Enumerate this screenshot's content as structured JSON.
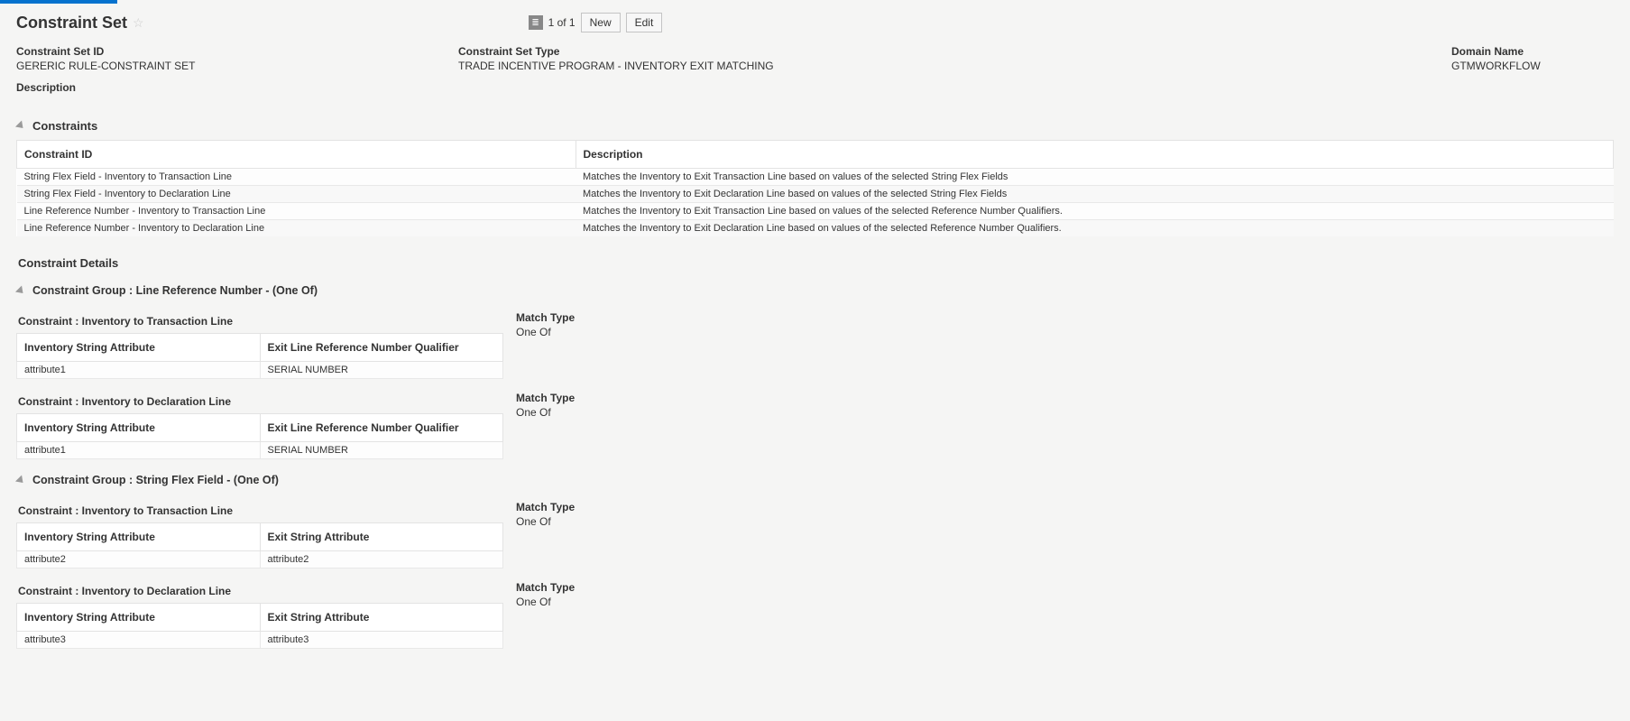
{
  "page": {
    "title": "Constraint Set",
    "pager": {
      "text": "1 of 1"
    },
    "buttons": {
      "new": "New",
      "edit": "Edit"
    }
  },
  "summary": {
    "id_label": "Constraint Set ID",
    "id_value": "GERERIC RULE-CONSTRAINT SET",
    "type_label": "Constraint Set Type",
    "type_value": "TRADE INCENTIVE PROGRAM - INVENTORY EXIT MATCHING",
    "domain_label": "Domain Name",
    "domain_value": "GTMWORKFLOW",
    "desc_label": "Description",
    "desc_value": ""
  },
  "constraints_section": {
    "title": "Constraints",
    "columns": {
      "id": "Constraint ID",
      "desc": "Description"
    },
    "rows": [
      {
        "id": "String Flex Field - Inventory to Transaction Line",
        "desc": "Matches the Inventory to Exit Transaction Line based on values of the selected String Flex Fields"
      },
      {
        "id": "String Flex Field - Inventory to Declaration Line",
        "desc": "Matches the Inventory to Exit Declaration Line based on values of the selected String Flex Fields"
      },
      {
        "id": "Line Reference Number - Inventory to Transaction Line",
        "desc": "Matches the Inventory to Exit Transaction Line based on values of the selected Reference Number Qualifiers."
      },
      {
        "id": "Line Reference Number - Inventory to Declaration Line",
        "desc": "Matches the Inventory to Exit Declaration Line based on values of the selected Reference Number Qualifiers."
      }
    ]
  },
  "details": {
    "title": "Constraint Details",
    "groups": [
      {
        "title": "Constraint Group : Line Reference Number - (One Of)",
        "constraints": [
          {
            "label": "Constraint : Inventory to Transaction Line",
            "match_label": "Match Type",
            "match_value": "One Of",
            "cols": {
              "c1": "Inventory String Attribute",
              "c2": "Exit Line Reference Number Qualifier"
            },
            "row": {
              "c1": "attribute1",
              "c2": "SERIAL NUMBER"
            }
          },
          {
            "label": "Constraint : Inventory to Declaration Line",
            "match_label": "Match Type",
            "match_value": "One Of",
            "cols": {
              "c1": "Inventory String Attribute",
              "c2": "Exit Line Reference Number Qualifier"
            },
            "row": {
              "c1": "attribute1",
              "c2": "SERIAL NUMBER"
            }
          }
        ]
      },
      {
        "title": "Constraint Group : String Flex Field - (One Of)",
        "constraints": [
          {
            "label": "Constraint : Inventory to Transaction Line",
            "match_label": "Match Type",
            "match_value": "One Of",
            "cols": {
              "c1": "Inventory String Attribute",
              "c2": "Exit String Attribute"
            },
            "row": {
              "c1": "attribute2",
              "c2": "attribute2"
            }
          },
          {
            "label": "Constraint : Inventory to Declaration Line",
            "match_label": "Match Type",
            "match_value": "One Of",
            "cols": {
              "c1": "Inventory String Attribute",
              "c2": "Exit String Attribute"
            },
            "row": {
              "c1": "attribute3",
              "c2": "attribute3"
            }
          }
        ]
      }
    ]
  }
}
